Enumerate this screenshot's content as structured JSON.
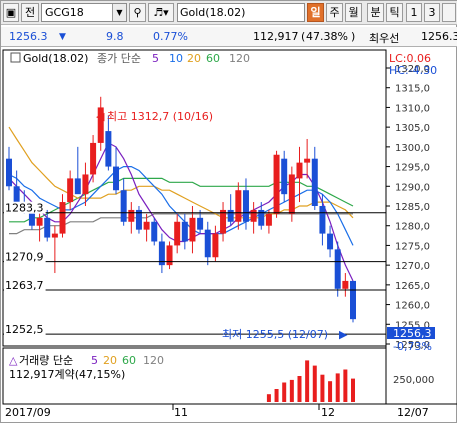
{
  "toolbar": {
    "code_prefix": "전",
    "symbol": "GCG18",
    "search_icon": "magnifier-icon",
    "sound_icon": "speaker-icon",
    "instrument": "Gold(18.02)",
    "periods": [
      "일",
      "주",
      "월",
      "분",
      "틱",
      "1",
      "3"
    ],
    "active_period": "일"
  },
  "infobar": {
    "price": "1256.3",
    "change_arrow": "▼",
    "change": "9.8",
    "change_pct": "0.77%",
    "volume": "112,917",
    "volume_pct": "47.38%",
    "bracket_close": ")",
    "preferred_label": "최우선",
    "preferred_price": "1256.3"
  },
  "chart": {
    "title": "Gold(18.02)",
    "ma_label": "종가 단순",
    "ma_periods": [
      "5",
      "10",
      "20",
      "60",
      "120"
    ],
    "lc": "LC:0.06",
    "hc": "HC:-4.30",
    "high_annotation": "최고 1312,7 (10/16)",
    "low_annotation": "최저 1255,5 (12/07)",
    "hlines": [
      "1283,3",
      "1270,9",
      "1263,7",
      "1252,5"
    ],
    "current_price_tag": "1256,3",
    "current_change_tag": "-0,73%",
    "volume_label": "거래량 단순",
    "volume_ma": [
      "5",
      "20",
      "60",
      "120"
    ],
    "volume_info": "112,917계약(47,15%)",
    "volume_axis": "250,000",
    "x_ticks": [
      "2017/09",
      "11",
      "12",
      "12/07"
    ],
    "colors": {
      "up": "#e81e1e",
      "down": "#1a4fd6",
      "ma5": "#7a1fbf",
      "ma10": "#1a6ee8",
      "ma20": "#e0a020",
      "ma60": "#2ea84a",
      "ma120": "#808080"
    }
  },
  "chart_data": {
    "type": "candlestick",
    "y_ticks": [
      1320,
      1315,
      1310,
      1305,
      1300,
      1295,
      1290,
      1285,
      1280,
      1275,
      1270,
      1265,
      1260,
      1255,
      1250
    ],
    "ylim": [
      1250,
      1320
    ],
    "candles": [
      {
        "o": 1297,
        "h": 1300,
        "l": 1289,
        "c": 1290
      },
      {
        "o": 1290,
        "h": 1294,
        "l": 1285,
        "c": 1286
      },
      {
        "o": 1286,
        "h": 1289,
        "l": 1283,
        "c": 1284
      },
      {
        "o": 1284,
        "h": 1285,
        "l": 1279,
        "c": 1280
      },
      {
        "o": 1280,
        "h": 1284,
        "l": 1276,
        "c": 1282
      },
      {
        "o": 1282,
        "h": 1284,
        "l": 1276,
        "c": 1277
      },
      {
        "o": 1277,
        "h": 1280,
        "l": 1268,
        "c": 1278
      },
      {
        "o": 1278,
        "h": 1288,
        "l": 1277,
        "c": 1286
      },
      {
        "o": 1286,
        "h": 1294,
        "l": 1284,
        "c": 1292
      },
      {
        "o": 1292,
        "h": 1300,
        "l": 1289,
        "c": 1288
      },
      {
        "o": 1288,
        "h": 1296,
        "l": 1285,
        "c": 1293
      },
      {
        "o": 1293,
        "h": 1303,
        "l": 1291,
        "c": 1301
      },
      {
        "o": 1301,
        "h": 1312.7,
        "l": 1299,
        "c": 1310
      },
      {
        "o": 1304,
        "h": 1308,
        "l": 1294,
        "c": 1295
      },
      {
        "o": 1295,
        "h": 1300,
        "l": 1288,
        "c": 1289
      },
      {
        "o": 1289,
        "h": 1292,
        "l": 1280,
        "c": 1281
      },
      {
        "o": 1281,
        "h": 1286,
        "l": 1278,
        "c": 1284
      },
      {
        "o": 1284,
        "h": 1285,
        "l": 1278,
        "c": 1279
      },
      {
        "o": 1279,
        "h": 1283,
        "l": 1276,
        "c": 1281
      },
      {
        "o": 1281,
        "h": 1282,
        "l": 1275,
        "c": 1276
      },
      {
        "o": 1276,
        "h": 1278,
        "l": 1268,
        "c": 1270
      },
      {
        "o": 1270,
        "h": 1276,
        "l": 1269,
        "c": 1275
      },
      {
        "o": 1275,
        "h": 1283,
        "l": 1273,
        "c": 1281
      },
      {
        "o": 1281,
        "h": 1283,
        "l": 1274,
        "c": 1276
      },
      {
        "o": 1276,
        "h": 1285,
        "l": 1273,
        "c": 1282
      },
      {
        "o": 1282,
        "h": 1284,
        "l": 1278,
        "c": 1279
      },
      {
        "o": 1279,
        "h": 1281,
        "l": 1270,
        "c": 1272
      },
      {
        "o": 1272,
        "h": 1280,
        "l": 1271,
        "c": 1278
      },
      {
        "o": 1278,
        "h": 1286,
        "l": 1276,
        "c": 1284
      },
      {
        "o": 1284,
        "h": 1288,
        "l": 1280,
        "c": 1281
      },
      {
        "o": 1281,
        "h": 1291,
        "l": 1279,
        "c": 1289
      },
      {
        "o": 1289,
        "h": 1292,
        "l": 1279,
        "c": 1281
      },
      {
        "o": 1281,
        "h": 1286,
        "l": 1278,
        "c": 1284
      },
      {
        "o": 1284,
        "h": 1286,
        "l": 1279,
        "c": 1280
      },
      {
        "o": 1280,
        "h": 1284,
        "l": 1278,
        "c": 1283
      },
      {
        "o": 1283,
        "h": 1299,
        "l": 1282,
        "c": 1298
      },
      {
        "o": 1297,
        "h": 1299,
        "l": 1286,
        "c": 1288
      },
      {
        "o": 1283,
        "h": 1295,
        "l": 1281,
        "c": 1293
      },
      {
        "o": 1292,
        "h": 1300,
        "l": 1286,
        "c": 1296
      },
      {
        "o": 1296,
        "h": 1302,
        "l": 1292,
        "c": 1297
      },
      {
        "o": 1297,
        "h": 1300,
        "l": 1284,
        "c": 1285
      },
      {
        "o": 1285,
        "h": 1288,
        "l": 1275,
        "c": 1278
      },
      {
        "o": 1278,
        "h": 1280,
        "l": 1272,
        "c": 1274
      },
      {
        "o": 1274,
        "h": 1276,
        "l": 1262,
        "c": 1264
      },
      {
        "o": 1264,
        "h": 1268,
        "l": 1262,
        "c": 1266
      },
      {
        "o": 1266,
        "h": 1266,
        "l": 1255.5,
        "c": 1256.3
      }
    ],
    "ma5": [
      1292,
      1290,
      1288,
      1286,
      1284,
      1282,
      1281,
      1281,
      1283,
      1286,
      1289,
      1293,
      1297,
      1301,
      1300,
      1297,
      1293,
      1288,
      1285,
      1282,
      1279,
      1277,
      1276,
      1276,
      1277,
      1278,
      1278,
      1278,
      1279,
      1280,
      1282,
      1283,
      1284,
      1285,
      1286,
      1288,
      1290,
      1291,
      1293,
      1293,
      1290,
      1286,
      1281,
      1275,
      1270,
      1266
    ],
    "ma10": [
      1293,
      1292,
      1290,
      1289,
      1287,
      1286,
      1285,
      1284,
      1284,
      1285,
      1286,
      1288,
      1290,
      1292,
      1294,
      1295,
      1295,
      1294,
      1292,
      1290,
      1288,
      1285,
      1283,
      1281,
      1279,
      1278,
      1278,
      1278,
      1278,
      1279,
      1280,
      1281,
      1282,
      1283,
      1284,
      1285,
      1286,
      1287,
      1288,
      1289,
      1289,
      1288,
      1286,
      1283,
      1279,
      1275
    ],
    "ma20": [
      1305,
      1302,
      1299,
      1296,
      1294,
      1292,
      1290,
      1289,
      1288,
      1287,
      1287,
      1287,
      1287,
      1288,
      1288,
      1289,
      1289,
      1290,
      1290,
      1290,
      1289,
      1289,
      1288,
      1287,
      1286,
      1285,
      1284,
      1283,
      1282,
      1282,
      1282,
      1282,
      1282,
      1282,
      1283,
      1283,
      1284,
      1284,
      1285,
      1285,
      1286,
      1286,
      1286,
      1285,
      1284,
      1282
    ],
    "ma60": [
      1281,
      1281,
      1281,
      1282,
      1282,
      1283,
      1284,
      1285,
      1286,
      1287,
      1288,
      1289,
      1290,
      1291,
      1291,
      1292,
      1292,
      1292,
      1292,
      1292,
      1292,
      1291,
      1291,
      1291,
      1291,
      1290,
      1290,
      1290,
      1290,
      1290,
      1290,
      1290,
      1290,
      1290,
      1290,
      1291,
      1291,
      1291,
      1291,
      1290,
      1290,
      1289,
      1288,
      1287,
      1286,
      1285
    ],
    "ma120": [
      1278,
      1278,
      1279,
      1279,
      1279,
      1280,
      1280,
      1280,
      1281,
      1281,
      1281,
      1281,
      1282,
      1282,
      1282,
      1282,
      1282,
      1282,
      1282,
      1283,
      1283,
      1283,
      1283,
      1283,
      1283,
      1283,
      1283,
      1283,
      1283,
      1283,
      1283,
      1283,
      1283,
      1283,
      1283,
      1283,
      1283,
      1283,
      1283,
      1283,
      1283,
      1283,
      1283,
      1283,
      1283,
      1283
    ],
    "volume": [
      0,
      0,
      0,
      0,
      0,
      0,
      0,
      0,
      0,
      0,
      0,
      0,
      0,
      0,
      0,
      0,
      0,
      0,
      0,
      0,
      0,
      0,
      0,
      0,
      0,
      0,
      0,
      0,
      0,
      0,
      0,
      0,
      0,
      0,
      60000,
      100000,
      150000,
      170000,
      200000,
      320000,
      280000,
      210000,
      160000,
      220000,
      250000,
      180000
    ],
    "volume_max": 400000
  }
}
